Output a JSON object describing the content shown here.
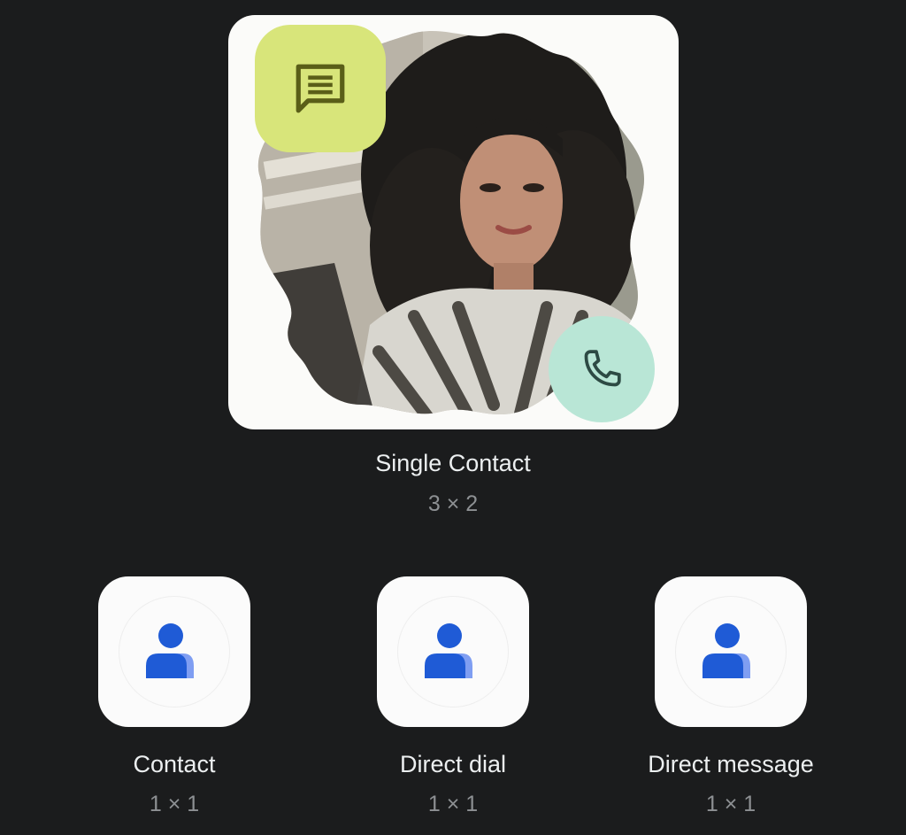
{
  "featured_widget": {
    "title": "Single Contact",
    "size": "3 × 2",
    "photo_icon": "contact-photo",
    "message_icon": "message-icon",
    "call_icon": "phone-icon",
    "colors": {
      "message_bg": "#d8e57a",
      "call_bg": "#b9e6d6",
      "card_bg": "#fbfbf9"
    }
  },
  "widgets": [
    {
      "label": "Contact",
      "size": "1 × 1",
      "icon": "person-icon"
    },
    {
      "label": "Direct dial",
      "size": "1 × 1",
      "icon": "person-icon"
    },
    {
      "label": "Direct message",
      "size": "1 × 1",
      "icon": "person-icon"
    }
  ],
  "colors": {
    "background": "#1b1c1d",
    "icon_blue": "#1f5bd6",
    "icon_blue_light": "#7f9ef2"
  }
}
